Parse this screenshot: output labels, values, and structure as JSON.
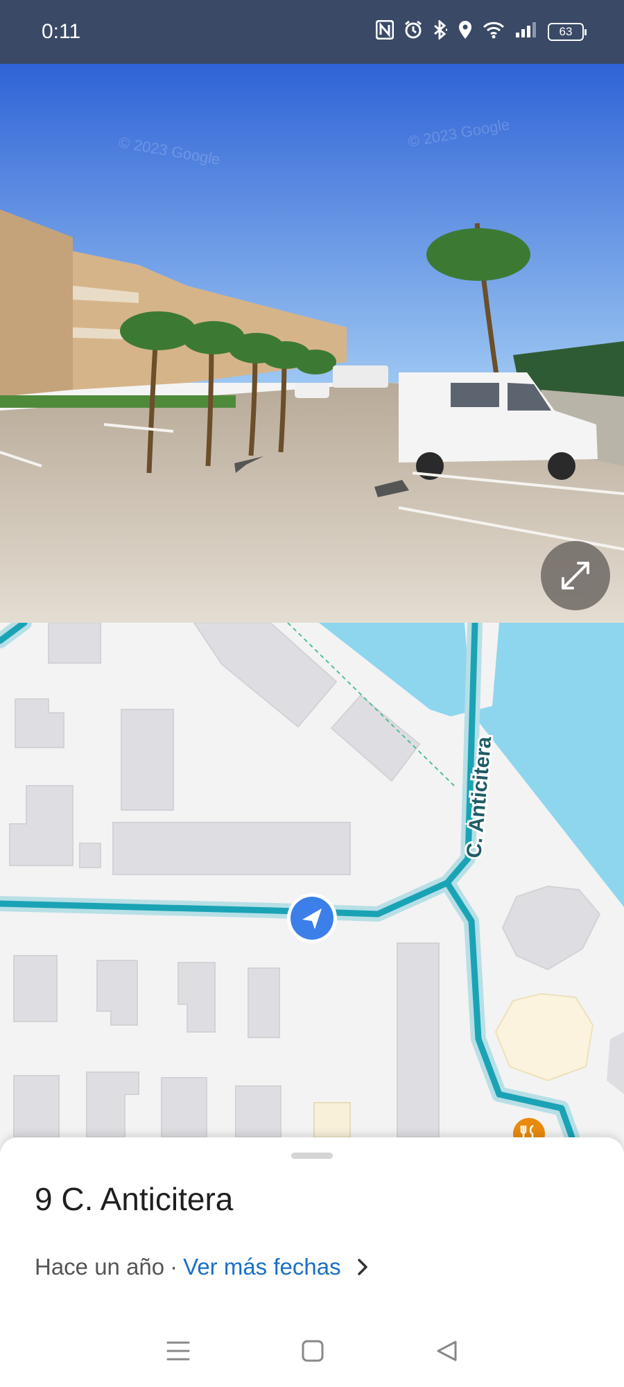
{
  "status_bar": {
    "time": "0:11",
    "battery": "63",
    "icons": [
      "nfc-icon",
      "alarm-icon",
      "bluetooth-icon",
      "location-icon",
      "wifi-icon",
      "signal-icon",
      "battery-icon"
    ]
  },
  "street_view": {
    "watermarks": [
      "© 2023 Google",
      "© 2023 Google"
    ],
    "expand_icon": "expand-icon"
  },
  "map": {
    "street_label": "C. Anticitera",
    "position_marker_icon": "navigation-arrow-icon",
    "poi_icon": "restaurant-icon",
    "colors": {
      "route": "#1aa3b5",
      "water": "#8dd6ee",
      "building": "#dedee2",
      "background": "#f3f3f3"
    }
  },
  "sheet": {
    "address": "9 C. Anticitera",
    "date_text": "Hace un año",
    "separator": "·",
    "more_dates_link": "Ver más fechas"
  },
  "nav_bar": {
    "icons": [
      "menu-icon",
      "home-icon",
      "back-icon"
    ]
  }
}
